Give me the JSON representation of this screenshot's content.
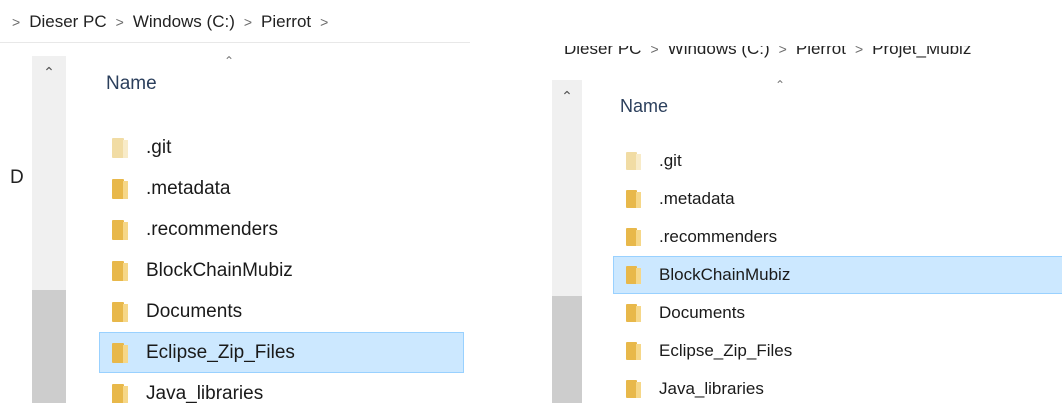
{
  "left_window": {
    "breadcrumb": [
      ">",
      "Dieser PC",
      "Windows (C:)",
      "Pierrot"
    ],
    "column_header": "Name",
    "side_fragment": "D",
    "selected_index": 5,
    "items": [
      {
        "name": ".git",
        "hidden": true
      },
      {
        "name": ".metadata",
        "hidden": false
      },
      {
        "name": ".recommenders",
        "hidden": false
      },
      {
        "name": "BlockChainMubiz",
        "hidden": false
      },
      {
        "name": "Documents",
        "hidden": false
      },
      {
        "name": "Eclipse_Zip_Files",
        "hidden": false
      },
      {
        "name": "Java_libraries",
        "hidden": false
      }
    ]
  },
  "right_window": {
    "breadcrumb": [
      "Dieser PC",
      "Windows (C:)",
      "Pierrot",
      "Projet_Mubiz"
    ],
    "column_header": "Name",
    "selected_index": 3,
    "items": [
      {
        "name": ".git",
        "hidden": true
      },
      {
        "name": ".metadata",
        "hidden": false
      },
      {
        "name": ".recommenders",
        "hidden": false
      },
      {
        "name": "BlockChainMubiz",
        "hidden": false
      },
      {
        "name": "Documents",
        "hidden": false
      },
      {
        "name": "Eclipse_Zip_Files",
        "hidden": false
      },
      {
        "name": "Java_libraries",
        "hidden": false
      }
    ]
  },
  "colors": {
    "selection_bg": "#cce8ff",
    "selection_border": "#99d1ff",
    "folder": "#e8b84a",
    "header_text": "#2b3f5c"
  }
}
